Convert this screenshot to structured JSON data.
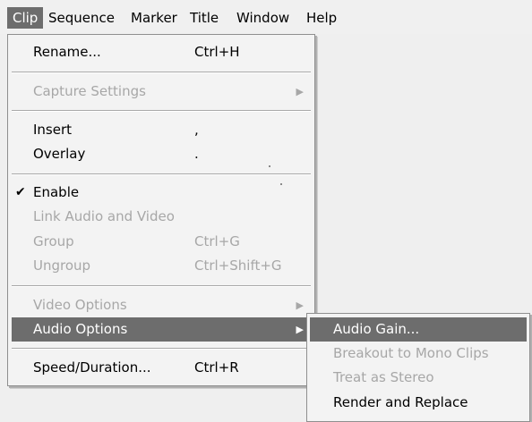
{
  "menubar": {
    "items": [
      {
        "label": "Clip",
        "active": true
      },
      {
        "label": "Sequence"
      },
      {
        "label": "Marker"
      },
      {
        "label": "Title"
      },
      {
        "label": "Window"
      },
      {
        "label": "Help"
      }
    ]
  },
  "clip_menu": {
    "rename": {
      "label": "Rename...",
      "shortcut": "Ctrl+H"
    },
    "capture_settings": {
      "label": "Capture Settings",
      "arrow": "▶"
    },
    "insert": {
      "label": "Insert",
      "shortcut": ","
    },
    "overlay": {
      "label": "Overlay",
      "shortcut": "."
    },
    "enable": {
      "label": "Enable",
      "check": "✔"
    },
    "link_audio_video": {
      "label": "Link Audio and Video"
    },
    "group": {
      "label": "Group",
      "shortcut": "Ctrl+G"
    },
    "ungroup": {
      "label": "Ungroup",
      "shortcut": "Ctrl+Shift+G"
    },
    "video_options": {
      "label": "Video Options",
      "arrow": "▶"
    },
    "audio_options": {
      "label": "Audio Options",
      "arrow": "▶"
    },
    "speed_duration": {
      "label": "Speed/Duration...",
      "shortcut": "Ctrl+R"
    }
  },
  "audio_submenu": {
    "audio_gain": {
      "label": "Audio Gain..."
    },
    "breakout_mono": {
      "label": "Breakout to Mono Clips"
    },
    "treat_stereo": {
      "label": "Treat as Stereo"
    },
    "render_replace": {
      "label": "Render and Replace"
    }
  },
  "colors": {
    "highlight": "#6d6d6d",
    "menu_background": "#f3f3f3",
    "disabled_text": "#a7a7a7"
  }
}
